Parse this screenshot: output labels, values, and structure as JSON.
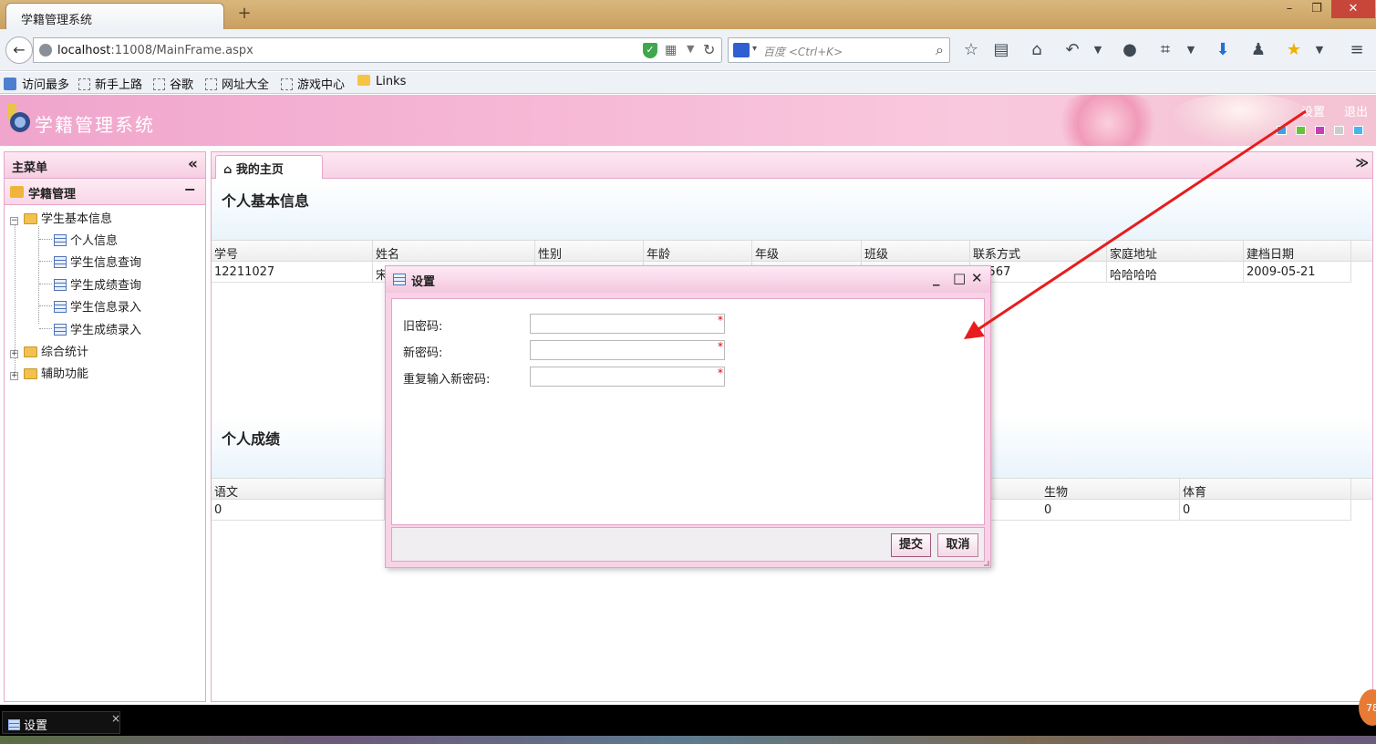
{
  "browser": {
    "tab_title": "学籍管理系统",
    "new_tab": "+",
    "window_min": "–",
    "window_max": "❐",
    "window_close": "✕",
    "url_host": "localhost",
    "url_rest": ":11008/MainFrame.aspx",
    "search_placeholder": "百度 <Ctrl+K>",
    "bookmarks": [
      "访问最多",
      "新手上路",
      "谷歌",
      "网址大全",
      "游戏中心",
      "Links"
    ]
  },
  "app": {
    "title": "学籍管理系统",
    "settings_link": "设置",
    "logout_link": "退出",
    "theme_colors": [
      "#3aa0e8",
      "#68c23a",
      "#c43fb8",
      "#cccccc",
      "#46b5f0"
    ]
  },
  "menu": {
    "title": "主菜单",
    "collapse": "«",
    "group": "学籍管理",
    "group_toggle": "−",
    "tree": {
      "student_basic": "学生基本信息",
      "items": [
        "个人信息",
        "学生信息查询",
        "学生成绩查询",
        "学生信息录入",
        "学生成绩录入"
      ],
      "stats": "综合统计",
      "aux": "辅助功能"
    }
  },
  "main": {
    "home_tab": "我的主页",
    "tabs_menu": "≫",
    "info_title": "个人基本信息",
    "info_columns": [
      "学号",
      "姓名",
      "性别",
      "年龄",
      "年级",
      "班级",
      "联系方式",
      "家庭地址",
      "建档日期"
    ],
    "info_row": [
      "12211027",
      "宋",
      "",
      "",
      "",
      "",
      "34567",
      "哈哈哈哈",
      "2009-05-21"
    ],
    "score_title": "个人成绩",
    "score_columns": [
      "语文",
      "",
      "",
      "",
      "",
      "",
      "生物",
      "体育"
    ],
    "score_row": [
      "0",
      "",
      "",
      "",
      "",
      "",
      "0",
      "0"
    ]
  },
  "dialog": {
    "title": "设置",
    "old_password_label": "旧密码:",
    "new_password_label": "新密码:",
    "repeat_password_label": "重复输入新密码:",
    "required_mark": "*",
    "submit": "提交",
    "cancel": "取消"
  },
  "taskbar": {
    "item": "设置",
    "close": "×",
    "badge": "78"
  }
}
